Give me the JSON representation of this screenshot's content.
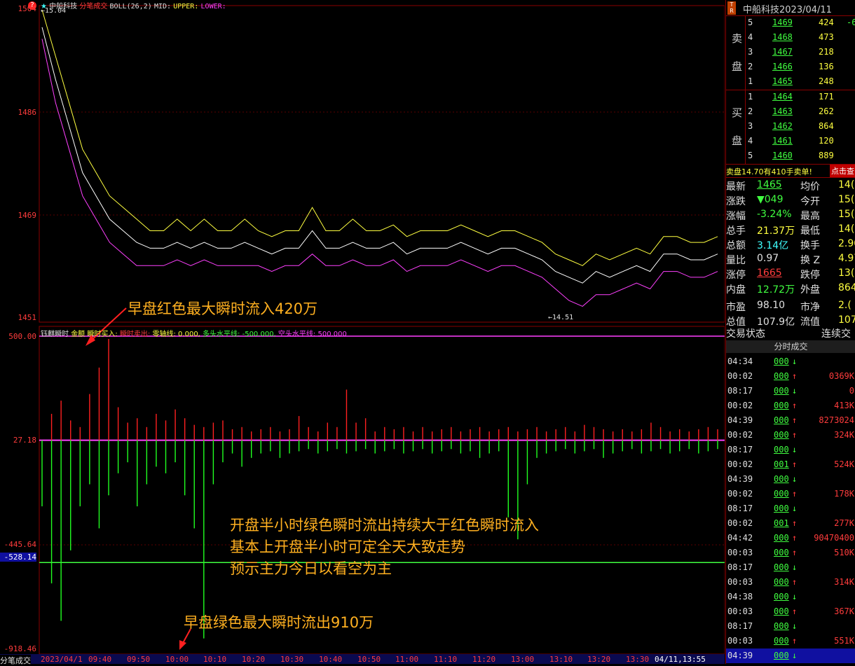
{
  "header": {
    "price_high_label": "1504",
    "star": "★",
    "stock_name": "中船科技",
    "mode": "分笔成交",
    "boll": "BOLL(26,2)",
    "mid": "MID:",
    "upper": "UPPER:",
    "lower": "LOWER:",
    "top_marker": "←15.04",
    "bottom_marker": "←14.51"
  },
  "price_axis": [
    "1504",
    "1486",
    "1469",
    "1451"
  ],
  "indicator_axis": [
    "500.00",
    "27.18",
    "-445.64",
    "-528.14",
    "-918.46"
  ],
  "indicator_header": {
    "name": "钰麒瞬时",
    "a": "金额",
    "b": "瞬时买入:",
    "c": "瞬时卖出:",
    "d": "零轴线: 0.000,",
    "e": "多头水平线: -500.000,",
    "f": "空头水平线: 500.000"
  },
  "annotations": {
    "top": "早盘红色最大瞬时流入420万",
    "middle_1": "开盘半小时绿色瞬时流出持续大于红色瞬时流入",
    "middle_2": "基本上开盘半小时可定全天大致走势",
    "middle_3": "预示主力今日以看空为主",
    "bottom": "早盘绿色最大瞬时流出910万"
  },
  "time_axis": {
    "left_label": "分笔成交",
    "date_start": "2023/04/1",
    "ticks": [
      "09:40",
      "09:50",
      "10:00",
      "10:10",
      "10:20",
      "10:30",
      "10:40",
      "10:50",
      "11:00",
      "11:10",
      "11:20",
      "13:00",
      "13:10",
      "13:20",
      "13:30"
    ],
    "date_end": "04/11,13:55"
  },
  "side": {
    "title": "中船科技2023/04/11",
    "tr_badge": "T R",
    "sell_label_1": "卖",
    "sell_label_2": "盘",
    "buy_label_1": "买",
    "buy_label_2": "盘",
    "asks": [
      {
        "lvl": "5",
        "price": "1469",
        "vol": "424",
        "chg": "-6"
      },
      {
        "lvl": "4",
        "price": "1468",
        "vol": "473",
        "chg": ""
      },
      {
        "lvl": "3",
        "price": "1467",
        "vol": "218",
        "chg": ""
      },
      {
        "lvl": "2",
        "price": "1466",
        "vol": "136",
        "chg": ""
      },
      {
        "lvl": "1",
        "price": "1465",
        "vol": "248",
        "chg": ""
      }
    ],
    "bids": [
      {
        "lvl": "1",
        "price": "1464",
        "vol": "171"
      },
      {
        "lvl": "2",
        "price": "1463",
        "vol": "262"
      },
      {
        "lvl": "3",
        "price": "1462",
        "vol": "864"
      },
      {
        "lvl": "4",
        "price": "1461",
        "vol": "120"
      },
      {
        "lvl": "5",
        "price": "1460",
        "vol": "889"
      }
    ],
    "notice": "卖盘14.70有410手卖单!",
    "notice_btn": "点击查",
    "stats": [
      {
        "l1": "最新",
        "v1": "1465",
        "c1": "green",
        "l2": "均价",
        "v2": "14("
      },
      {
        "l1": "涨跌",
        "v1": "▼049",
        "c1": "green",
        "l2": "今开",
        "v2": "15("
      },
      {
        "l1": "涨幅",
        "v1": "-3.24%",
        "c1": "green",
        "l2": "最高",
        "v2": "15("
      },
      {
        "l1": "总手",
        "v1": "21.37万",
        "c1": "yellow",
        "l2": "最低",
        "v2": "14("
      },
      {
        "l1": "总额",
        "v1": "3.14亿",
        "c1": "cyan",
        "l2": "换手",
        "v2": "2.90"
      },
      {
        "l1": "量比",
        "v1": "0.97",
        "c1": "white",
        "l2": "换 Z",
        "v2": "4.97"
      },
      {
        "l1": "涨停",
        "v1": "1665",
        "c1": "red",
        "l2": "跌停",
        "v2": "13("
      },
      {
        "l1": "内盘",
        "v1": "12.72万",
        "c1": "green",
        "l2": "外盘",
        "v2": "864"
      },
      {
        "l1": "市盈",
        "v1": "98.10",
        "c1": "white",
        "l2": "市净",
        "v2": "2.("
      },
      {
        "l1": "总值",
        "v1": "107.9亿",
        "c1": "white",
        "l2": "流值",
        "v2": "107.9"
      }
    ],
    "trade_status_label": "交易状态",
    "trade_status": "连续交",
    "ticks_header": "分时成交",
    "ticks": [
      {
        "t": "04:34",
        "v": "000",
        "d": "↓",
        "x": ""
      },
      {
        "t": "00:02",
        "v": "000",
        "d": "↑",
        "x": "0369K"
      },
      {
        "t": "08:17",
        "v": "000",
        "d": "↓",
        "x": "0"
      },
      {
        "t": "00:02",
        "v": "000",
        "d": "↑",
        "x": "413K"
      },
      {
        "t": "04:39",
        "v": "000",
        "d": "↑",
        "x": "8273024"
      },
      {
        "t": "00:02",
        "v": "000",
        "d": "↑",
        "x": "324K"
      },
      {
        "t": "08:17",
        "v": "000",
        "d": "↓",
        "x": ""
      },
      {
        "t": "00:02",
        "v": "001",
        "d": "↑",
        "x": "524K"
      },
      {
        "t": "04:39",
        "v": "000",
        "d": "↓",
        "x": ""
      },
      {
        "t": "00:02",
        "v": "000",
        "d": "↑",
        "x": "178K"
      },
      {
        "t": "08:17",
        "v": "000",
        "d": "↓",
        "x": ""
      },
      {
        "t": "00:02",
        "v": "001",
        "d": "↑",
        "x": "277K"
      },
      {
        "t": "04:42",
        "v": "000",
        "d": "↑",
        "x": "90470400"
      },
      {
        "t": "00:03",
        "v": "000",
        "d": "↑",
        "x": "510K"
      },
      {
        "t": "08:17",
        "v": "000",
        "d": "↓",
        "x": ""
      },
      {
        "t": "00:03",
        "v": "000",
        "d": "↑",
        "x": "314K"
      },
      {
        "t": "04:38",
        "v": "000",
        "d": "↓",
        "x": ""
      },
      {
        "t": "00:03",
        "v": "000",
        "d": "↑",
        "x": "367K"
      },
      {
        "t": "08:17",
        "v": "000",
        "d": "↓",
        "x": ""
      },
      {
        "t": "00:03",
        "v": "000",
        "d": "↑",
        "x": "551K"
      },
      {
        "t": "04:39",
        "v": "000",
        "d": "↓",
        "x": ""
      }
    ]
  },
  "chart_data": [
    {
      "type": "line",
      "xlabel": "",
      "ylabel": "",
      "ylim": [
        14.51,
        15.04
      ],
      "series": [
        {
          "name": "UPPER",
          "color": "#ffff40",
          "values": [
            15.04,
            14.96,
            14.88,
            14.8,
            14.76,
            14.72,
            14.7,
            14.68,
            14.66,
            14.66,
            14.68,
            14.66,
            14.68,
            14.66,
            14.66,
            14.68,
            14.66,
            14.65,
            14.66,
            14.66,
            14.7,
            14.66,
            14.66,
            14.68,
            14.66,
            14.66,
            14.67,
            14.65,
            14.66,
            14.66,
            14.66,
            14.67,
            14.66,
            14.65,
            14.66,
            14.66,
            14.65,
            14.64,
            14.62,
            14.61,
            14.6,
            14.62,
            14.61,
            14.62,
            14.63,
            14.62,
            14.65,
            14.65,
            14.64,
            14.64,
            14.65
          ]
        },
        {
          "name": "MID",
          "color": "#ffffff",
          "values": [
            15.01,
            14.92,
            14.84,
            14.76,
            14.72,
            14.68,
            14.66,
            14.64,
            14.63,
            14.63,
            14.64,
            14.63,
            14.64,
            14.63,
            14.63,
            14.64,
            14.63,
            14.62,
            14.63,
            14.63,
            14.66,
            14.63,
            14.63,
            14.64,
            14.63,
            14.63,
            14.64,
            14.62,
            14.63,
            14.63,
            14.63,
            14.64,
            14.63,
            14.62,
            14.63,
            14.63,
            14.62,
            14.61,
            14.59,
            14.58,
            14.57,
            14.59,
            14.58,
            14.59,
            14.6,
            14.59,
            14.62,
            14.62,
            14.61,
            14.61,
            14.62
          ]
        },
        {
          "name": "LOWER",
          "color": "#ff40ff",
          "values": [
            14.99,
            14.88,
            14.8,
            14.72,
            14.68,
            14.64,
            14.62,
            14.6,
            14.6,
            14.6,
            14.61,
            14.6,
            14.61,
            14.6,
            14.6,
            14.6,
            14.6,
            14.59,
            14.6,
            14.6,
            14.62,
            14.6,
            14.6,
            14.61,
            14.6,
            14.6,
            14.61,
            14.59,
            14.6,
            14.6,
            14.6,
            14.61,
            14.6,
            14.59,
            14.6,
            14.6,
            14.59,
            14.58,
            14.56,
            14.54,
            14.53,
            14.55,
            14.55,
            14.56,
            14.57,
            14.56,
            14.59,
            14.59,
            14.58,
            14.58,
            14.59
          ]
        }
      ]
    },
    {
      "type": "bar",
      "xlabel": "",
      "ylabel": "",
      "ylim": [
        -918.46,
        500.0
      ],
      "reference_lines": [
        500.0,
        27.18,
        -528.14
      ],
      "series": [
        {
          "name": "瞬时买入",
          "color": "#ff2020",
          "values": [
            0,
            120,
            180,
            90,
            60,
            210,
            330,
            460,
            150,
            80,
            100,
            60,
            120,
            90,
            140,
            100,
            70,
            60,
            80,
            90,
            50,
            60,
            40,
            50,
            60,
            40,
            50,
            110,
            60,
            40,
            80,
            60,
            230,
            80,
            100,
            40,
            60,
            50,
            60,
            40,
            60,
            40,
            50,
            60,
            40,
            50,
            60,
            40,
            50,
            60,
            40,
            50,
            60,
            40,
            50,
            60,
            40,
            70,
            60,
            50,
            40,
            50,
            40,
            50,
            80,
            60,
            40,
            50,
            40,
            50,
            60,
            50
          ]
        },
        {
          "name": "瞬时卖出",
          "color": "#20ff20",
          "values": [
            -300,
            -650,
            -820,
            -500,
            -300,
            -200,
            -400,
            -250,
            -150,
            -100,
            -300,
            -200,
            -120,
            -150,
            -100,
            -250,
            -400,
            -900,
            -200,
            -100,
            -60,
            -120,
            -80,
            -60,
            -50,
            -80,
            -60,
            -50,
            -40,
            -60,
            -50,
            -40,
            -60,
            -50,
            -40,
            -60,
            -50,
            -40,
            -60,
            -50,
            -40,
            -60,
            -50,
            -40,
            -60,
            -50,
            -80,
            -60,
            -50,
            -350,
            -450,
            -200,
            -80,
            -60,
            -50,
            -40,
            -60,
            -50,
            -40,
            -80,
            -60,
            -50,
            -40,
            -60,
            -50,
            -40,
            -60,
            -50,
            -40,
            -60,
            -50,
            -40
          ]
        }
      ]
    }
  ]
}
